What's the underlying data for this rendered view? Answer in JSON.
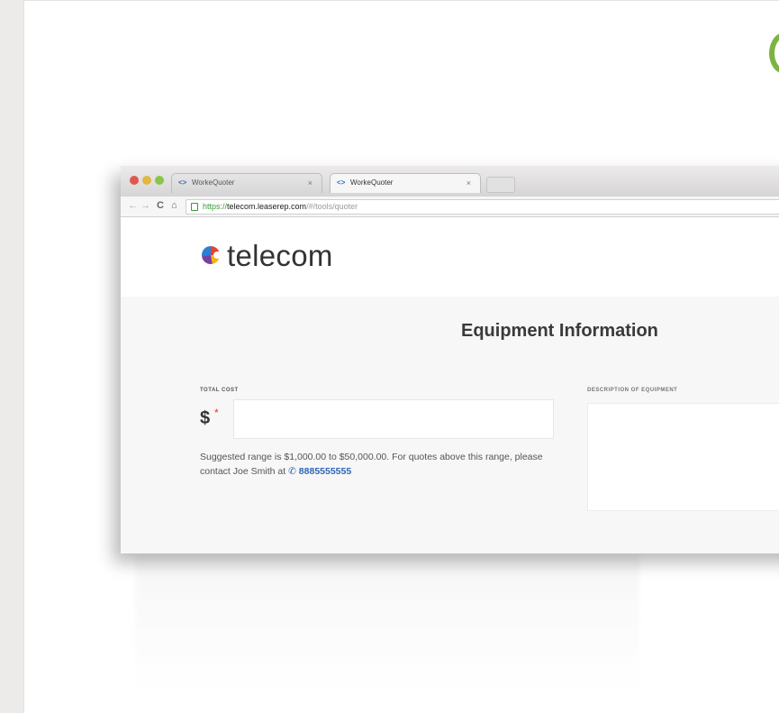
{
  "browser": {
    "tabs": [
      {
        "label": "WorkeQuoter",
        "close": "×",
        "active": false
      },
      {
        "label": "WorkeQuoter",
        "close": "×",
        "active": true
      }
    ],
    "toolbar": {
      "back": "←",
      "forward": "→",
      "reload": "C",
      "home": "⌂"
    },
    "url": {
      "scheme": "https://",
      "host": "telecom.leaserep.com",
      "path": "/#/tools/quoter"
    }
  },
  "app": {
    "brand": "telecom",
    "section_title": "Equipment Information",
    "total_cost": {
      "label": "TOTAL COST",
      "currency": "$",
      "required_marker": "*",
      "value": ""
    },
    "description": {
      "label": "DESCRIPTION OF EQUIPMENT",
      "value": ""
    },
    "hint": {
      "text": "Suggested range is $1,000.00 to $50,000.00. For quotes above this range, please contact Joe Smith at",
      "phone_icon": "✆",
      "phone": "8885555555"
    }
  },
  "colors": {
    "accent_green": "#7cb342",
    "link_blue": "#2e66b8",
    "required_red": "#e53935"
  }
}
